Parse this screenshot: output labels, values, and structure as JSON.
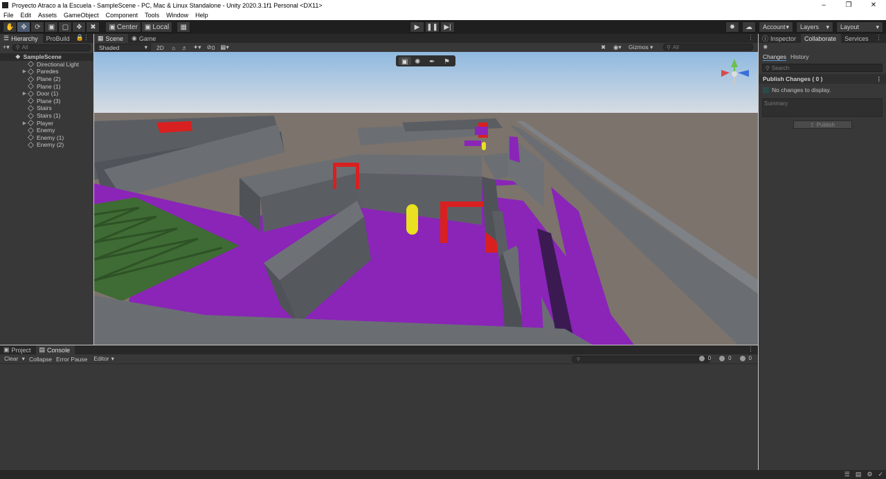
{
  "window": {
    "title": "Proyecto Atraco a la Escuela - SampleScene - PC, Mac & Linux Standalone - Unity 2020.3.1f1 Personal <DX11>"
  },
  "menu": [
    "File",
    "Edit",
    "Assets",
    "GameObject",
    "Component",
    "Tools",
    "Window",
    "Help"
  ],
  "toolbar": {
    "pivot_label": "Center",
    "space_label": "Local",
    "account_label": "Account",
    "layers_label": "Layers",
    "layout_label": "Layout"
  },
  "hierarchy": {
    "tabs": [
      "Hierarchy",
      "ProBuild"
    ],
    "search_placeholder": "All",
    "scene": "SampleScene",
    "items": [
      {
        "label": "Directional Light",
        "expandable": false
      },
      {
        "label": "Paredes",
        "expandable": true
      },
      {
        "label": "Plane (2)",
        "expandable": false
      },
      {
        "label": "Plane (1)",
        "expandable": false
      },
      {
        "label": "Door (1)",
        "expandable": true
      },
      {
        "label": "Plane (3)",
        "expandable": false
      },
      {
        "label": "Stairs",
        "expandable": false
      },
      {
        "label": "Stairs (1)",
        "expandable": false
      },
      {
        "label": "Player",
        "expandable": true
      },
      {
        "label": "Enemy",
        "expandable": false
      },
      {
        "label": "Enemy (1)",
        "expandable": false
      },
      {
        "label": "Enemy (2)",
        "expandable": false
      }
    ]
  },
  "scene": {
    "tabs": [
      "Scene",
      "Game"
    ],
    "shading_mode": "Shaded",
    "mode_2d": "2D",
    "hidden_count": "0",
    "gizmos_label": "Gizmos",
    "search_placeholder": "All",
    "colors": {
      "sky_top": "#8fb9e0",
      "ground": "#7c736c",
      "floor": "#8a25b8",
      "wall": "#5a5e63",
      "door": "#d82020",
      "stairs": "#3f6b34",
      "player": "#e8e020"
    }
  },
  "inspector": {
    "tabs": [
      "Inspector",
      "Collaborate",
      "Services"
    ],
    "collab_tabs": [
      "Changes",
      "History"
    ],
    "search_placeholder": "Search",
    "publish_header": "Publish Changes ( 0 )",
    "no_changes": "No changes to display.",
    "summary_placeholder": "Summary",
    "publish_button": "Publish"
  },
  "console": {
    "tabs": [
      "Project",
      "Console"
    ],
    "buttons": [
      "Clear",
      "Collapse",
      "Error Pause",
      "Editor"
    ],
    "counts": {
      "log": "0",
      "warn": "0",
      "error": "0"
    }
  }
}
